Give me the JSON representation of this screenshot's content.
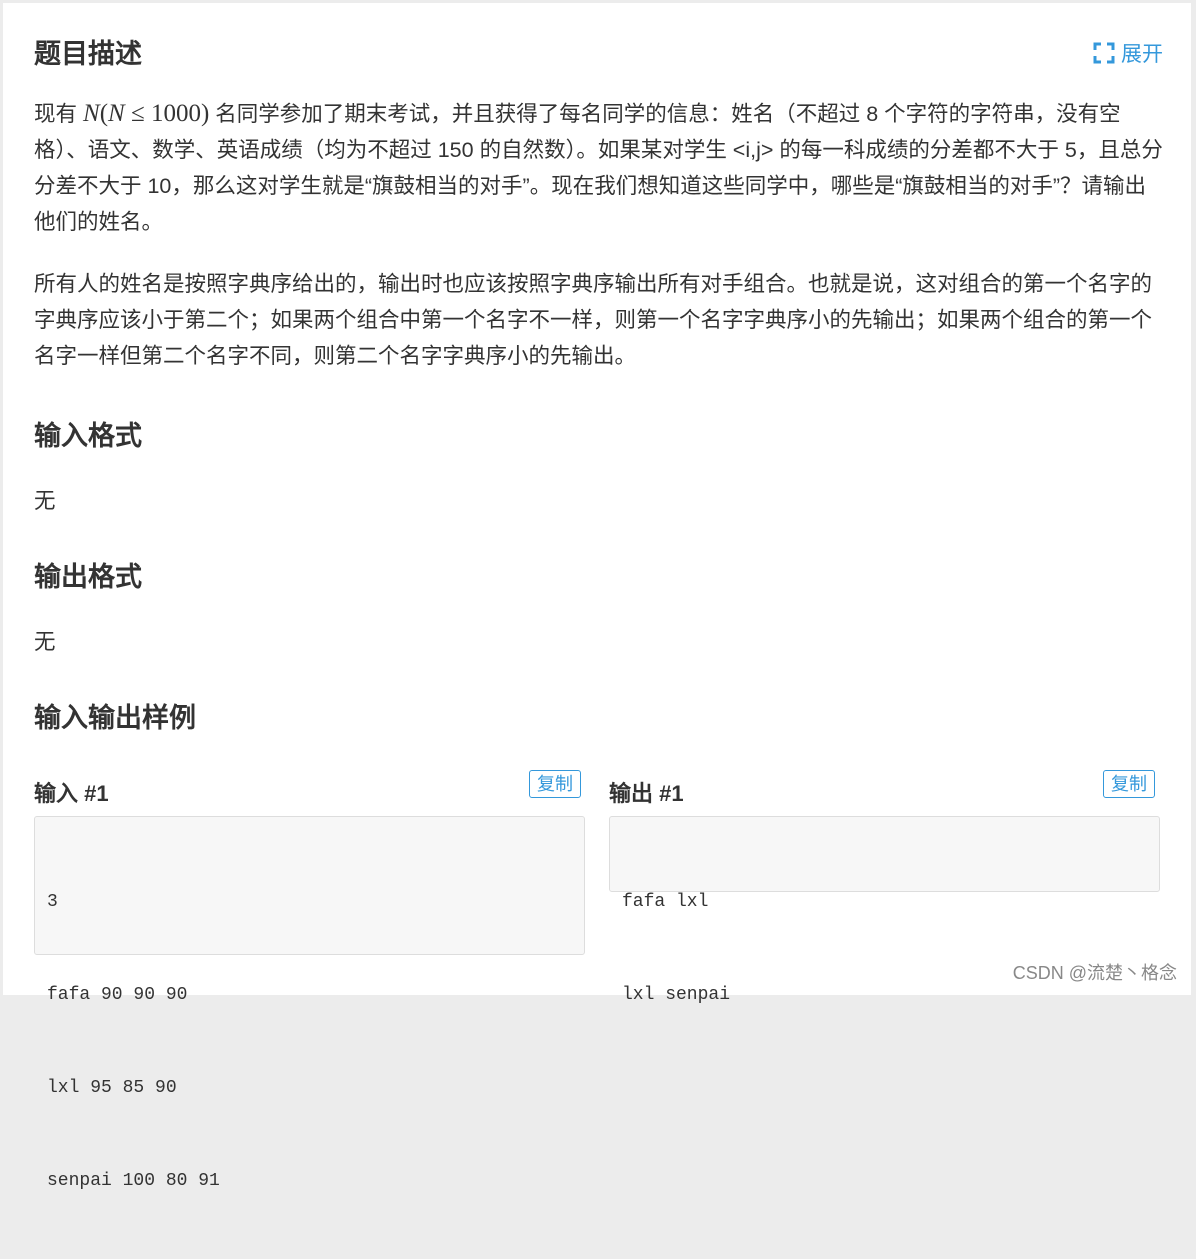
{
  "expand": {
    "icon": "expand-icon",
    "label": "展开",
    "color": "#3498db"
  },
  "sections": {
    "description": {
      "title": "题目描述",
      "para1_prefix": "现有",
      "math_n": "N",
      "math_open": "(",
      "math_n2": "N",
      "math_le": "≤",
      "math_num": "1000",
      "math_close": ")",
      "para1_rest": "名同学参加了期末考试，并且获得了每名同学的信息：姓名（不超过 8 个字符的字符串，没有空格）、语文、数学、英语成绩（均为不超过 150 的自然数）。如果某对学生 <i,j> 的每一科成绩的分差都不大于 5，且总分分差不大于 10，那么这对学生就是“旗鼓相当的对手”。现在我们想知道这些同学中，哪些是“旗鼓相当的对手”？请输出他们的姓名。",
      "para2": "所有人的姓名是按照字典序给出的，输出时也应该按照字典序输出所有对手组合。也就是说，这对组合的第一个名字的字典序应该小于第二个；如果两个组合中第一个名字不一样，则第一个名字字典序小的先输出；如果两个组合的第一个名字一样但第二个名字不同，则第二个名字字典序小的先输出。"
    },
    "input_format": {
      "title": "输入格式",
      "body": "无"
    },
    "output_format": {
      "title": "输出格式",
      "body": "无"
    },
    "samples": {
      "title": "输入输出样例",
      "input_label": "输入 #1",
      "output_label": "输出 #1",
      "copy_label": "复制",
      "input_lines": [
        "3",
        "fafa 90 90 90",
        "lxl 95 85 90",
        "senpai 100 80 91"
      ],
      "output_lines": [
        "fafa lxl",
        "lxl senpai"
      ]
    }
  },
  "watermark": "CSDN @流楚丶格念"
}
